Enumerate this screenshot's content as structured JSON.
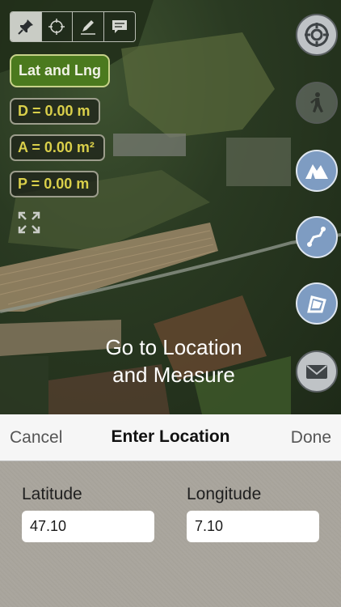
{
  "toolbar": {
    "tools": [
      {
        "icon": "pin-icon",
        "active": true
      },
      {
        "icon": "crosshair-icon",
        "active": false
      },
      {
        "icon": "pencil-icon",
        "active": false
      },
      {
        "icon": "message-icon",
        "active": false
      }
    ]
  },
  "left_panel": {
    "latlng_label": "Lat and Lng",
    "distance": "D = 0.00 m",
    "area": "A = 0.00 m²",
    "perimeter": "P = 0.00 m"
  },
  "right_buttons": [
    {
      "icon": "locate-icon",
      "style": "grey"
    },
    {
      "icon": "walker-icon",
      "style": "dim"
    },
    {
      "icon": "mountain-icon",
      "style": "blue"
    },
    {
      "icon": "route-icon",
      "style": "blue"
    },
    {
      "icon": "area-icon",
      "style": "blue"
    },
    {
      "icon": "mail-icon",
      "style": "grey"
    }
  ],
  "caption": {
    "line1": "Go to Location",
    "line2": "and Measure"
  },
  "sheet": {
    "cancel_label": "Cancel",
    "title": "Enter Location",
    "done_label": "Done",
    "latitude_label": "Latitude",
    "latitude_value": "47.10",
    "longitude_label": "Longitude",
    "longitude_value": "7.10"
  },
  "colors": {
    "latlng_button": "#4b7a1e",
    "measure_text": "#d9cf4a",
    "blue_button": "#7e9cc2"
  }
}
